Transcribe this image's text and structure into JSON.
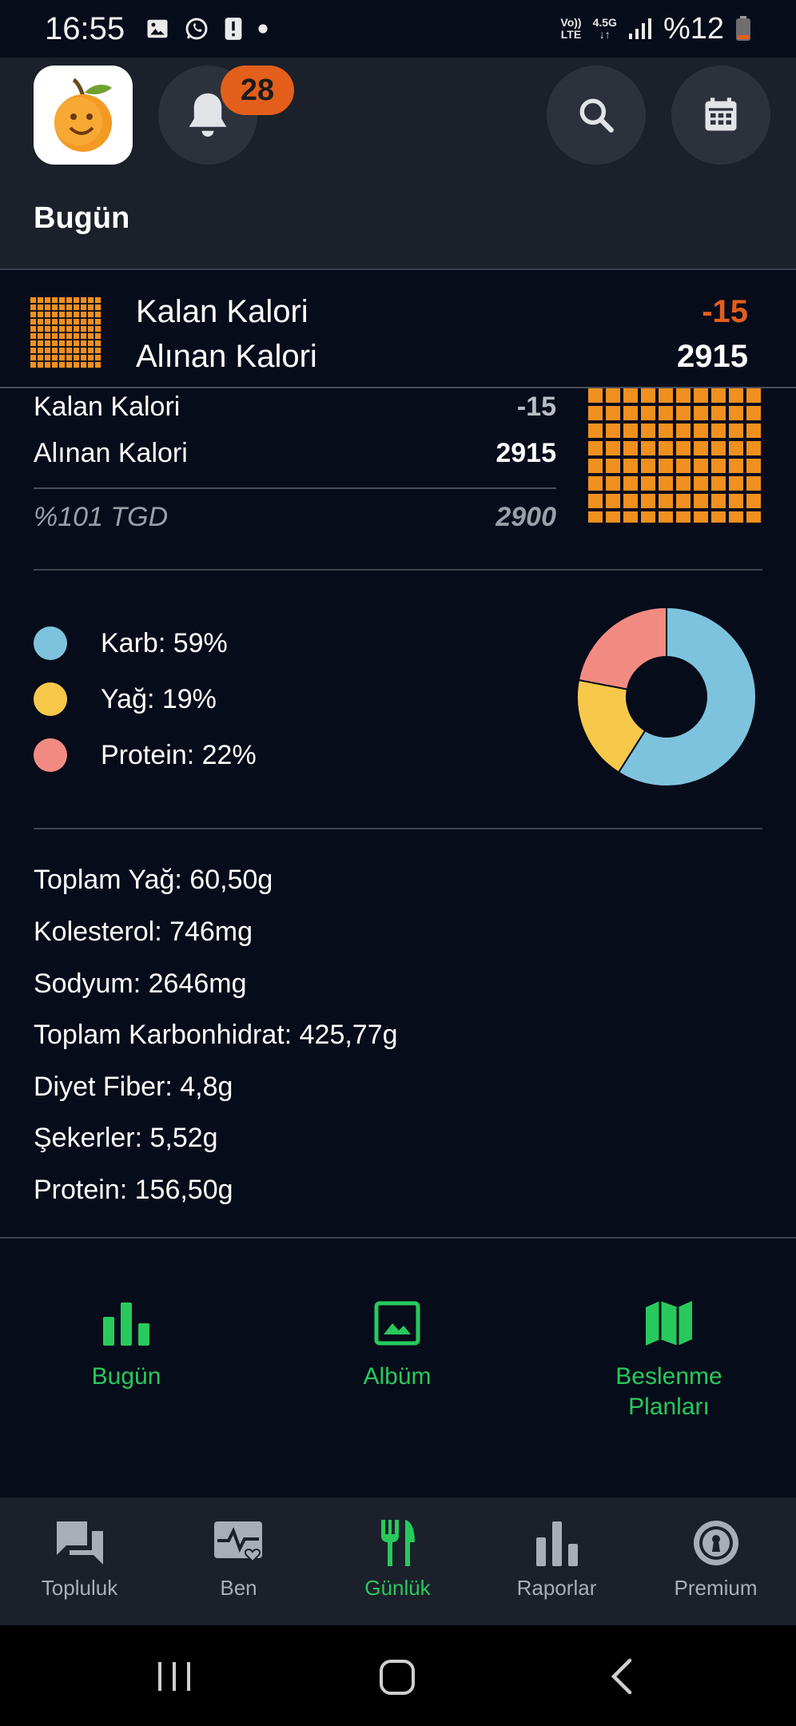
{
  "status_bar": {
    "time": "16:55",
    "net_top": "Vo))",
    "net_bottom": "LTE",
    "gen_top": "4.5G",
    "battery": "%12",
    "icons": [
      "image-icon",
      "whatsapp-icon",
      "alert-icon",
      "dot-icon",
      "signal-icon",
      "battery-icon"
    ]
  },
  "header": {
    "notification_count": "28",
    "title": "Bugün"
  },
  "summary": {
    "remaining_label": "Kalan Kalori",
    "remaining_value": "-15",
    "consumed_label": "Alınan Kalori",
    "consumed_value": "2915"
  },
  "calories": {
    "remaining_label": "Kalan Kalori",
    "remaining_value": "-15",
    "consumed_label": "Alınan Kalori",
    "consumed_value": "2915",
    "tgd_label": "%101 TGD",
    "tgd_value": "2900"
  },
  "macros": {
    "items": [
      {
        "label": "Karb: 59%",
        "percent": 59,
        "color": "#7ec3dd"
      },
      {
        "label": "Yağ: 19%",
        "percent": 19,
        "color": "#f7c84a"
      },
      {
        "label": "Protein: 22%",
        "percent": 22,
        "color": "#f28b82"
      }
    ]
  },
  "nutrients": [
    "Toplam Yağ: 60,50g",
    "Kolesterol: 746mg",
    "Sodyum: 2646mg",
    "Toplam Karbonhidrat: 425,77g",
    "Diyet Fiber: 4,8g",
    "Şekerler: 5,52g",
    "Protein: 156,50g"
  ],
  "quick_links": {
    "today": "Bugün",
    "album": "Albüm",
    "plans_line1": "Beslenme",
    "plans_line2": "Planları"
  },
  "bottom_nav": {
    "items": [
      {
        "label": "Topluluk",
        "icon": "forum-icon"
      },
      {
        "label": "Ben",
        "icon": "health-icon"
      },
      {
        "label": "Günlük",
        "icon": "cutlery-icon"
      },
      {
        "label": "Raporlar",
        "icon": "bar-chart-icon"
      },
      {
        "label": "Premium",
        "icon": "premium-icon"
      }
    ],
    "active_index": 2
  },
  "colors": {
    "accent_green": "#28c95c",
    "over_orange": "#e35f1b",
    "grid_orange": "#f0901e"
  }
}
